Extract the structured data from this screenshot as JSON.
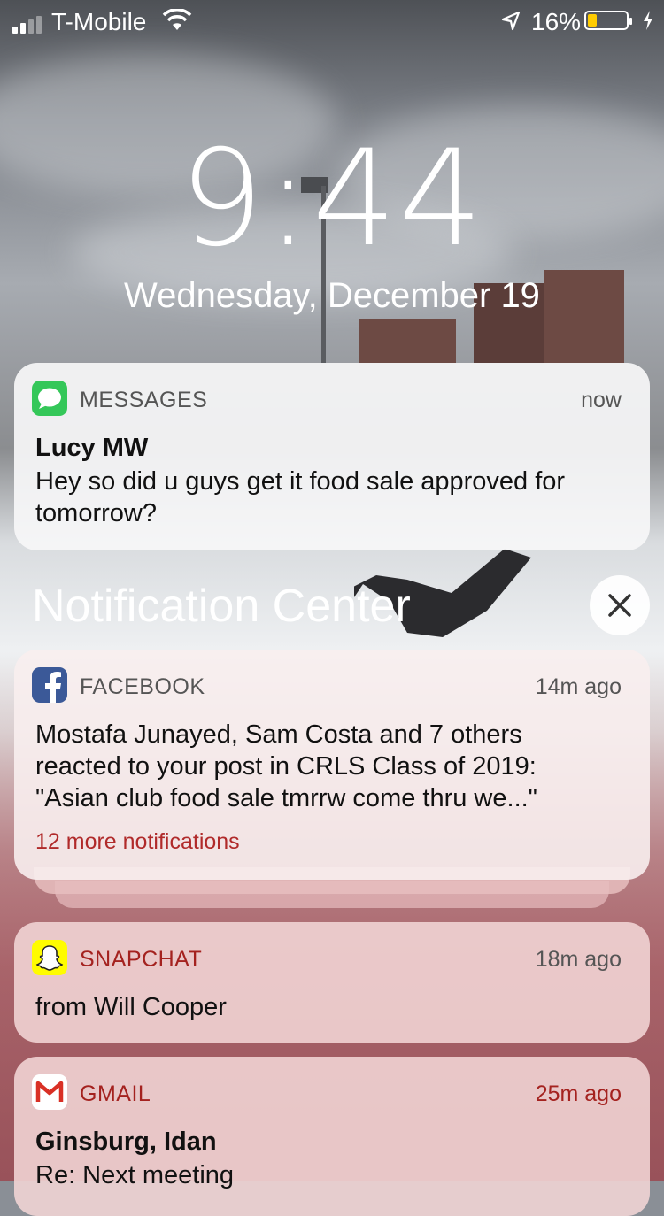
{
  "status_bar": {
    "carrier": "T-Mobile",
    "battery_percent": "16%",
    "battery_level": 0.16,
    "icons": [
      "signal-icon",
      "wifi-icon",
      "location-icon",
      "battery-icon",
      "charging-icon"
    ]
  },
  "lock_screen": {
    "time": "9:44",
    "date": "Wednesday, December 19"
  },
  "notification_center": {
    "title": "Notification Center"
  },
  "notifications": {
    "messages": {
      "app": "MESSAGES",
      "time": "now",
      "sender": "Lucy MW",
      "body": "Hey so did u guys get it food sale  approved for tomorrow?"
    },
    "facebook": {
      "app": "FACEBOOK",
      "time": "14m ago",
      "body": "Mostafa Junayed, Sam Costa and 7 others reacted to your post in CRLS Class of 2019: \"Asian club food sale tmrrw come thru we...\"",
      "more": "12 more notifications"
    },
    "snapchat": {
      "app": "SNAPCHAT",
      "time": "18m ago",
      "body": "from Will Cooper"
    },
    "gmail": {
      "app": "GMAIL",
      "time": "25m ago",
      "sender": "Ginsburg, Idan",
      "subject": "Re: Next meeting"
    }
  },
  "colors": {
    "messages_green": "#34c759",
    "facebook_blue": "#3b5998",
    "snapchat_yellow": "#fffc00",
    "gmail_red": "#d93025",
    "battery_yellow": "#ffcc00"
  }
}
